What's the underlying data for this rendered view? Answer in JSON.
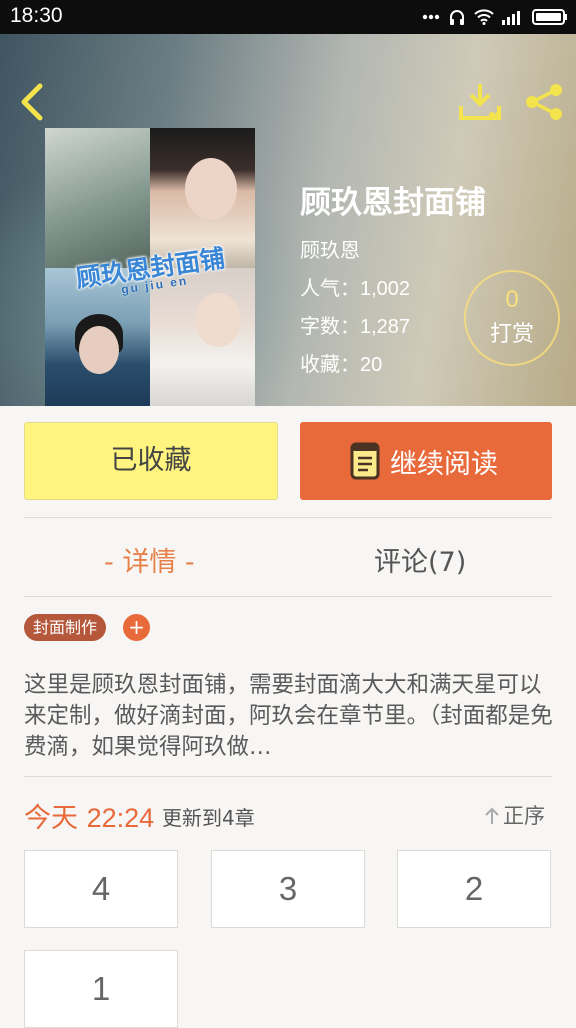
{
  "status_bar": {
    "time": "18:30"
  },
  "header": {
    "cover": {
      "title": "顾玖恩封面铺",
      "subtitle": "gu jiu en"
    },
    "book_title": "顾玖恩封面铺",
    "author": "顾玖恩",
    "stats": [
      {
        "label": "人气：",
        "value": "1,002"
      },
      {
        "label": "字数：",
        "value": "1,287"
      },
      {
        "label": "收藏：",
        "value": "20"
      }
    ],
    "reward": {
      "count": "0",
      "label": "打赏"
    }
  },
  "actions": {
    "collect_label": "已收藏",
    "read_label": "继续阅读"
  },
  "tabs": {
    "details": "- 详情 -",
    "comments": "评论(7)"
  },
  "tag": {
    "label": "封面制作",
    "add": "+"
  },
  "description": "这里是顾玖恩封面铺，需要封面滴大大和满天星可以来定制，做好滴封面，阿玖会在章节里。（封面都是免费滴，如果觉得阿玖做…",
  "update": {
    "day": "今天",
    "time": "22:24",
    "info": "更新到4章",
    "order_label": "正序"
  },
  "chapters": [
    "4",
    "3",
    "2",
    "1"
  ],
  "colors": {
    "accent": "#e8693a",
    "collect_bg": "#fef47f",
    "tag_bg": "#b4573a",
    "reward_gold": "#f7e27a"
  }
}
